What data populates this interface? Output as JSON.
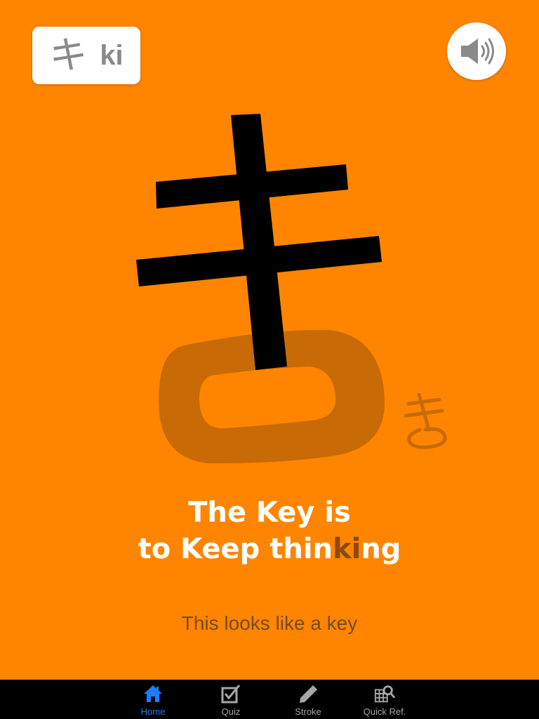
{
  "kana_card": {
    "katakana": "キ",
    "romaji": "ki"
  },
  "sound_button": {
    "icon": "speaker-icon"
  },
  "illustration": {
    "hiragana": "き",
    "small_hiragana": "き"
  },
  "mnemonic": {
    "line1": "The Key is",
    "line2_prefix": "to Keep thin",
    "line2_highlight": "ki",
    "line2_suffix": "ng"
  },
  "caption": "This looks like a key",
  "colors": {
    "background": "#FF8500",
    "highlight": "#8a4a12",
    "active_tab": "#1e7cff"
  },
  "tabbar": {
    "items": [
      {
        "label": "Home",
        "icon": "home-icon",
        "active": true
      },
      {
        "label": "Quiz",
        "icon": "quiz-checkbox-icon",
        "active": false
      },
      {
        "label": "Stroke",
        "icon": "pencil-icon",
        "active": false
      },
      {
        "label": "Quick Ref.",
        "icon": "grid-magnifier-icon",
        "active": false
      }
    ]
  }
}
